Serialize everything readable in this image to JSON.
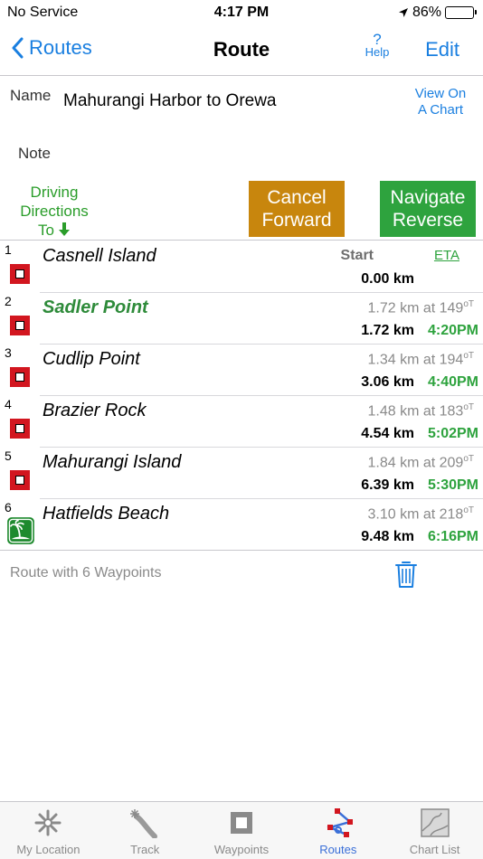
{
  "status_bar": {
    "carrier": "No Service",
    "time": "4:17 PM",
    "battery": "86%",
    "battery_level": 0.86
  },
  "nav": {
    "back_label": "Routes",
    "title": "Route",
    "help_label": "Help",
    "help_symbol": "?",
    "edit_label": "Edit"
  },
  "route": {
    "name_label": "Name",
    "name_value": "Mahurangi Harbor to Orewa",
    "view_chart_line1": "View On",
    "view_chart_line2": "A Chart",
    "note_label": "Note"
  },
  "actions": {
    "driving_line1": "Driving",
    "driving_line2": "Directions",
    "driving_line3": "To",
    "cancel_line1": "Cancel",
    "cancel_line2": "Forward",
    "navigate_line1": "Navigate",
    "navigate_line2": "Reverse"
  },
  "list_header": {
    "start_label": "Start",
    "eta_label": "ETA"
  },
  "waypoints": [
    {
      "num": "1",
      "name": "Casnell Island",
      "leg": "",
      "degrees": "",
      "dist": "0.00 km",
      "eta": "",
      "icon": "red-square-icon"
    },
    {
      "num": "2",
      "name": "Sadler Point",
      "leg": "1.72 km at 149",
      "degrees": "oT",
      "dist": "1.72 km",
      "eta": "4:20PM",
      "icon": "red-square-icon"
    },
    {
      "num": "3",
      "name": "Cudlip Point",
      "leg": "1.34 km at 194",
      "degrees": "oT",
      "dist": "3.06 km",
      "eta": "4:40PM",
      "icon": "red-square-icon"
    },
    {
      "num": "4",
      "name": "Brazier Rock",
      "leg": "1.48 km at 183",
      "degrees": "oT",
      "dist": "4.54 km",
      "eta": "5:02PM",
      "icon": "red-square-icon"
    },
    {
      "num": "5",
      "name": "Mahurangi Island",
      "leg": "1.84 km at 209",
      "degrees": "oT",
      "dist": "6.39 km",
      "eta": "5:30PM",
      "icon": "red-square-icon"
    },
    {
      "num": "6",
      "name": "Hatfields Beach",
      "leg": "3.10 km at 218",
      "degrees": "oT",
      "dist": "9.48 km",
      "eta": "6:16PM",
      "icon": "beach-icon"
    }
  ],
  "footer": {
    "summary": "Route with 6 Waypoints"
  },
  "tabs": [
    {
      "label": "My Location",
      "icon": "my-location-icon"
    },
    {
      "label": "Track",
      "icon": "track-icon"
    },
    {
      "label": "Waypoints",
      "icon": "waypoints-icon"
    },
    {
      "label": "Routes",
      "icon": "routes-icon",
      "selected": true
    },
    {
      "label": "Chart List",
      "icon": "chart-list-icon"
    }
  ],
  "colors": {
    "accent_blue": "#1a7fe0",
    "green": "#2ea33e",
    "orange_button": "#c8860d",
    "waypoint_red": "#d2161f"
  }
}
